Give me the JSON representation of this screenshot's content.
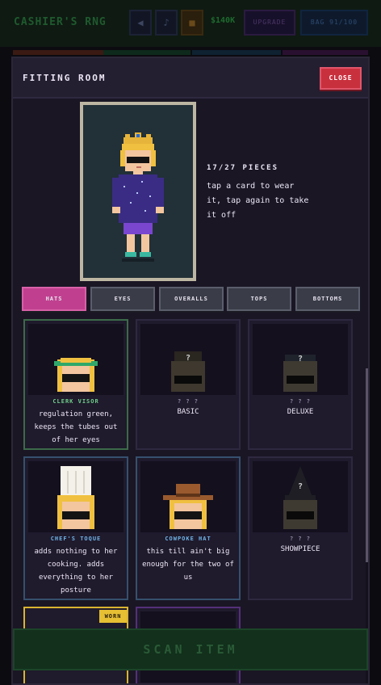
{
  "header": {
    "game_title": "CASHIER'S RNG",
    "money": "$140K",
    "upgrade_label": "UPGRADE",
    "bag_label": "BAG 91/100"
  },
  "modal": {
    "title": "FITTING ROOM",
    "close_label": "CLOSE",
    "pieces": "17/27 PIECES",
    "hint": "tap a card to wear it, tap again to take it off"
  },
  "tabs": [
    {
      "label": "HATS",
      "active": true
    },
    {
      "label": "EYES",
      "active": false
    },
    {
      "label": "OVERALLS",
      "active": false
    },
    {
      "label": "TOPS",
      "active": false
    },
    {
      "label": "BOTTOMS",
      "active": false
    }
  ],
  "cards": [
    {
      "name": "CLERK VISOR",
      "desc": "regulation green, keeps the tubes out of her eyes",
      "name_color": "#6fcf8a",
      "locked": false
    },
    {
      "name": "? ? ?",
      "desc": "BASIC",
      "locked": true
    },
    {
      "name": "? ? ?",
      "desc": "DELUXE",
      "locked": true
    },
    {
      "name": "CHEF'S TOQUE",
      "desc": "adds nothing to her cooking. adds everything to her posture",
      "name_color": "#6fb4e8",
      "locked": false
    },
    {
      "name": "COWPOKE HAT",
      "desc": "this till ain't big enough for the two of us",
      "name_color": "#6fb4e8",
      "locked": false
    },
    {
      "name": "? ? ?",
      "desc": "SHOWPIECE",
      "locked": true
    }
  ],
  "worn_label": "WORN",
  "scan_label": "SCAN ITEM",
  "colors": {
    "accent_tab": "#c0408f",
    "close": "#c9303e",
    "worn_badge": "#e6bf33"
  }
}
